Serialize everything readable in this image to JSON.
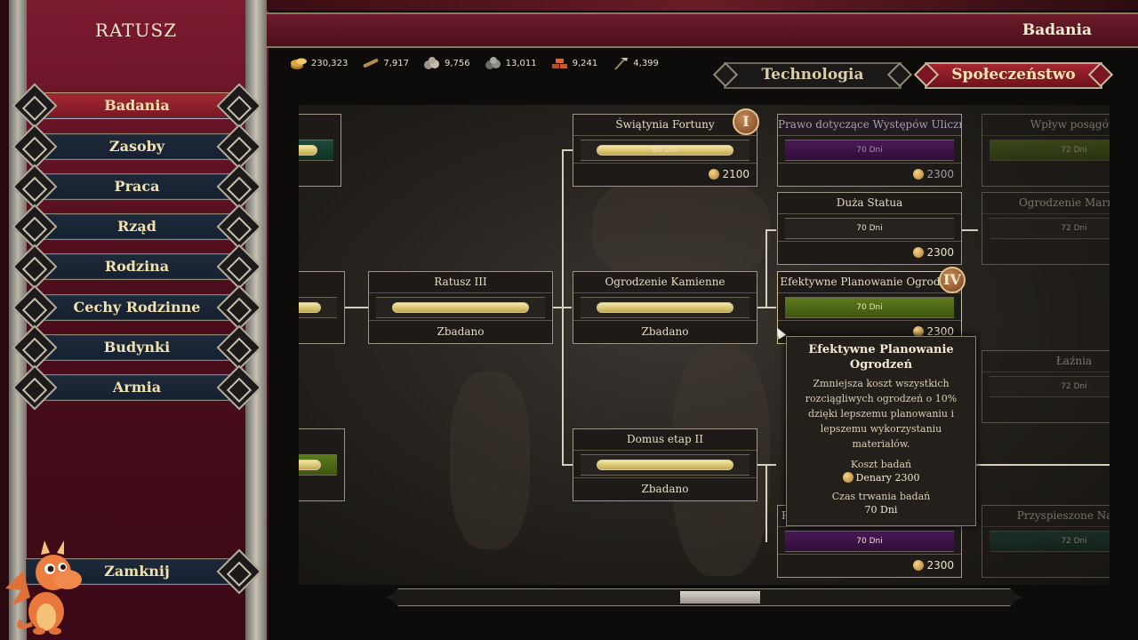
{
  "left_panel": {
    "title": "RATUSZ",
    "nav": [
      {
        "label": "Badania",
        "active": true
      },
      {
        "label": "Zasoby",
        "active": false
      },
      {
        "label": "Praca",
        "active": false
      },
      {
        "label": "Rząd",
        "active": false
      },
      {
        "label": "Rodzina",
        "active": false
      },
      {
        "label": "Cechy Rodzinne",
        "active": false
      },
      {
        "label": "Budynki",
        "active": false
      },
      {
        "label": "Armia",
        "active": false
      }
    ],
    "close_label": "Zamknij"
  },
  "header": {
    "title": "Badania"
  },
  "resources": [
    {
      "icon": "coins-icon",
      "value": "230,323"
    },
    {
      "icon": "wood-icon",
      "value": "7,917"
    },
    {
      "icon": "stone-icon",
      "value": "9,756"
    },
    {
      "icon": "ore-icon",
      "value": "13,011"
    },
    {
      "icon": "bricks-icon",
      "value": "9,241"
    },
    {
      "icon": "tools-icon",
      "value": "4,399"
    }
  ],
  "tabs": [
    {
      "label": "Technologia",
      "active": false
    },
    {
      "label": "Społeczeństwo",
      "active": true
    }
  ],
  "cards": {
    "swiatynia": {
      "name": "Świątynia Fortuny",
      "bar": "68 Dni",
      "cost": "2100",
      "badge": "I"
    },
    "prawo": {
      "name": "Prawo dotyczące Występów Ulicznych",
      "bar": "70 Dni",
      "cost": "2300"
    },
    "wplyw": {
      "name": "Wpływ posągów",
      "bar": "72 Dni"
    },
    "duza_statua": {
      "name": "Duża Statua",
      "bar": "70 Dni",
      "cost": "2300"
    },
    "ogrodzenie_marmur": {
      "name": "Ogrodzenie Marmur",
      "bar": "72 Dni"
    },
    "ratusz3": {
      "name": "Ratusz III",
      "status": "Zbadano"
    },
    "ogrodzenie_kam": {
      "name": "Ogrodzenie Kamienne",
      "status": "Zbadano"
    },
    "efektywne": {
      "name": "Efektywne Planowanie Ogrodzeń",
      "bar": "70 Dni",
      "cost": "2300",
      "badge": "IV"
    },
    "laznia": {
      "name": "Łaźnia",
      "bar": "72 Dni"
    },
    "domus": {
      "name": "Domus etap II",
      "status": "Zbadano"
    },
    "purple_bottom": {
      "name": "Po",
      "bar": "70 Dni",
      "cost": "2300"
    },
    "przyspieszone": {
      "name": "Przyspieszone Naucz",
      "bar": "72 Dni"
    }
  },
  "tooltip": {
    "title": "Efektywne Planowanie Ogrodzeń",
    "description": "Zmniejsza koszt wszystkich rozciągliwych ogrodzeń o 10% dzięki lepszemu planowaniu i lepszemu wykorzystaniu materiałów.",
    "cost_heading": "Koszt badań",
    "cost_value": "Denary 2300",
    "time_heading": "Czas trwania badań",
    "time_value": "70 Dni"
  },
  "colors": {
    "panel_red": "#7c1a30",
    "active_button": "#a42a34",
    "nav_button": "#1e2a3a",
    "purple_bar": "#4a1a56",
    "green_bar": "#5e7a1c",
    "teal_bar": "#1c4a3a",
    "progress_gold": "#f4e7a4"
  }
}
